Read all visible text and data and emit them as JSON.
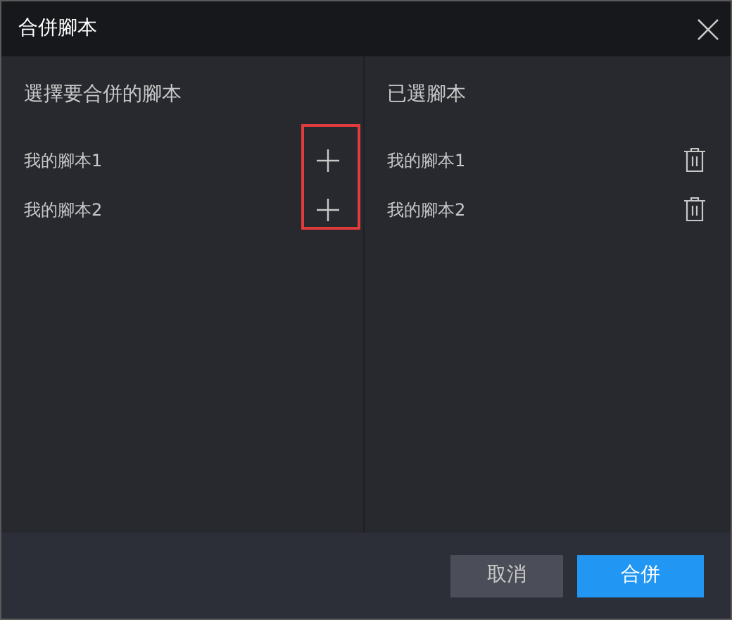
{
  "window": {
    "title": "合併腳本"
  },
  "available": {
    "heading": "選擇要合併的腳本",
    "items": [
      {
        "name": "我的腳本1"
      },
      {
        "name": "我的腳本2"
      }
    ]
  },
  "selected": {
    "heading": "已選腳本",
    "items": [
      {
        "name": "我的腳本1"
      },
      {
        "name": "我的腳本2"
      }
    ]
  },
  "buttons": [
    {
      "label": "取消",
      "kind": "secondary"
    },
    {
      "label": "合併",
      "kind": "primary"
    }
  ]
}
